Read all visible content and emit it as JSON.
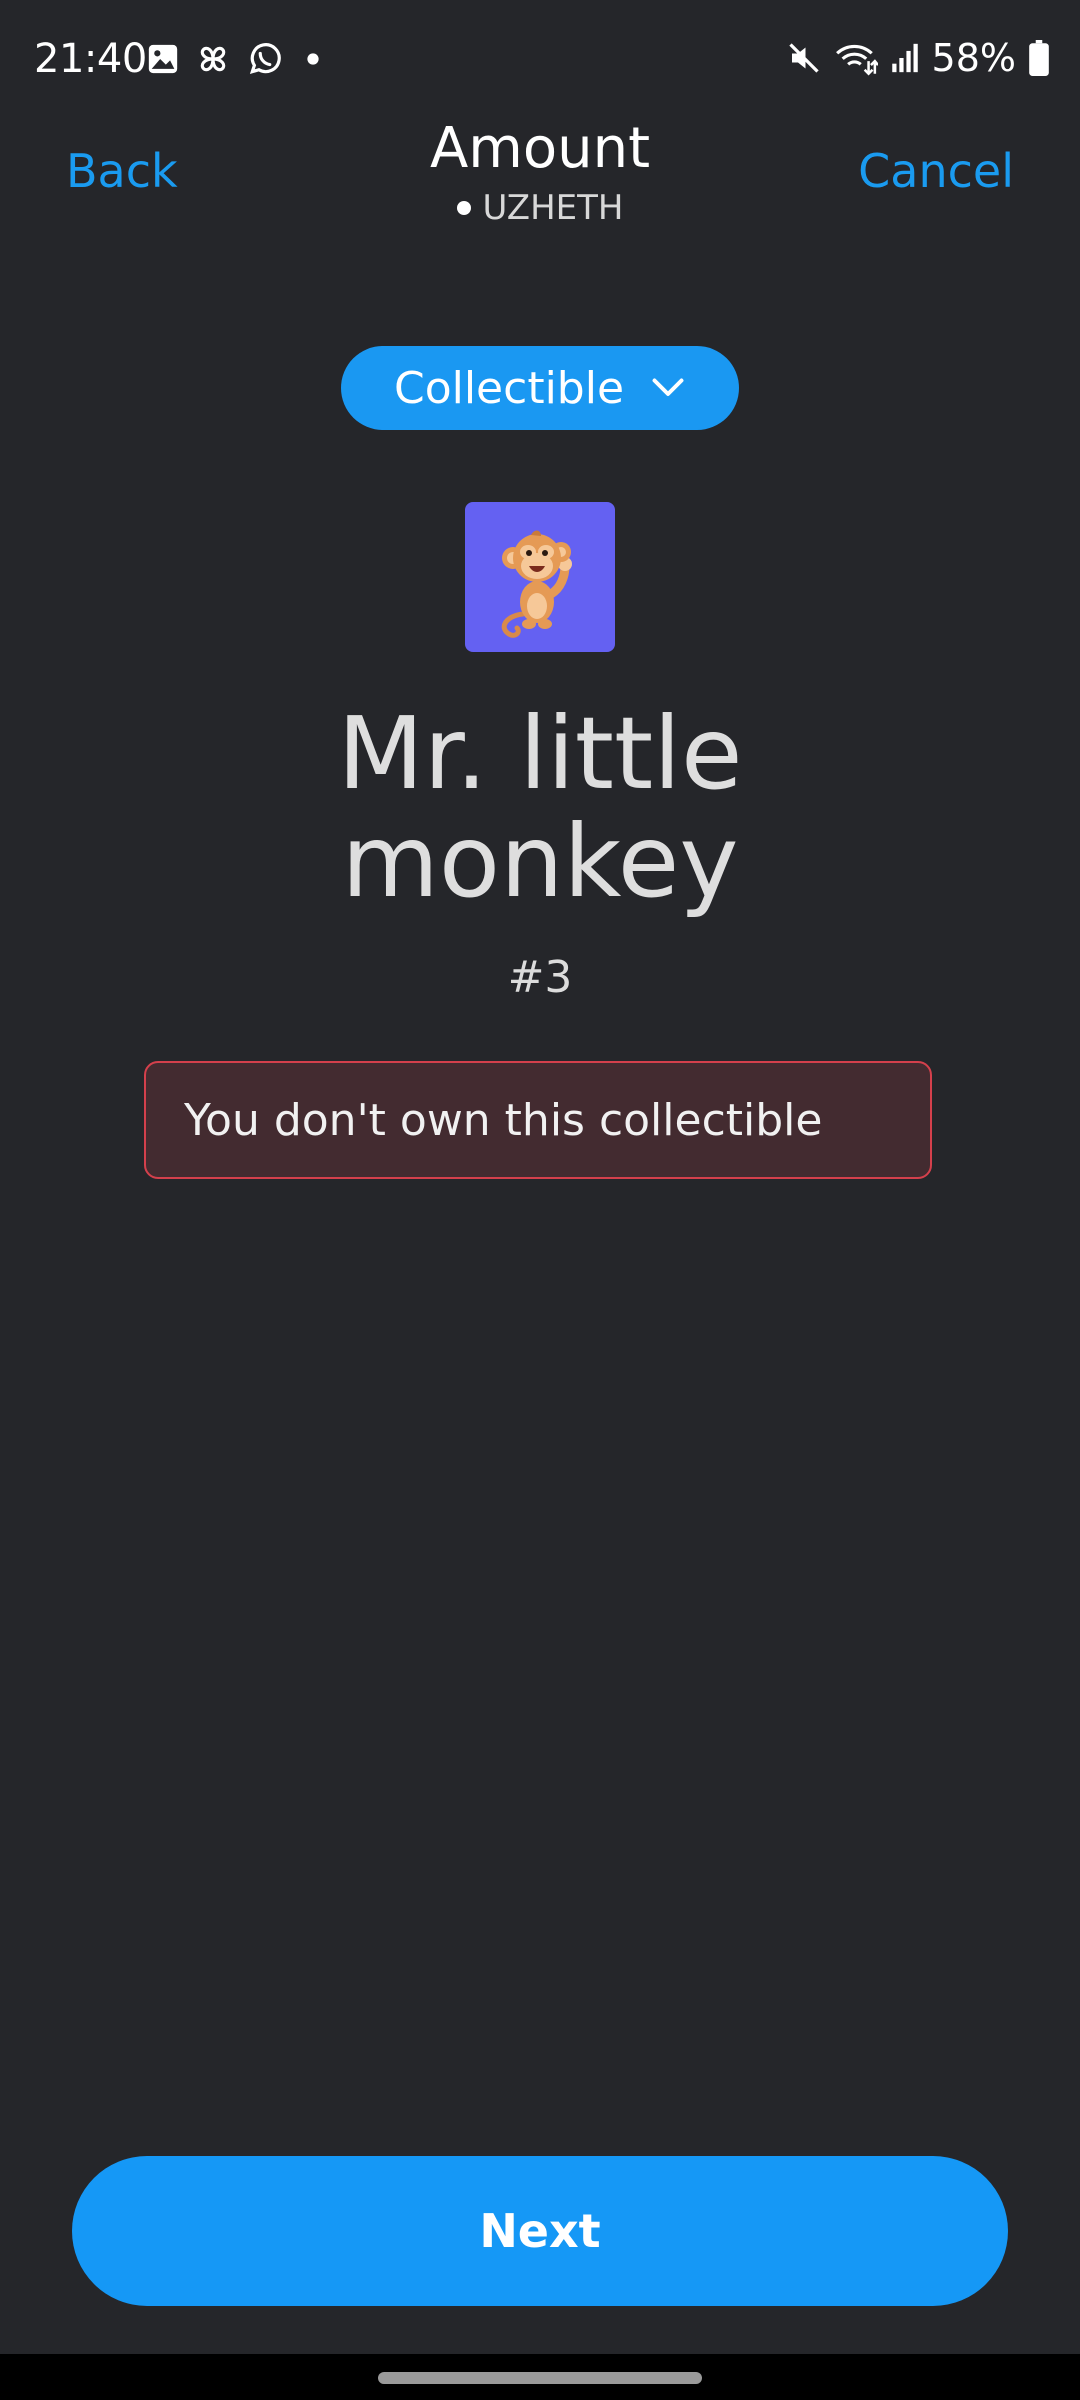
{
  "status_bar": {
    "time": "21:40",
    "battery_text": "58%",
    "left_icons": [
      "gallery-icon",
      "pinwheel-icon",
      "whatsapp-icon",
      "notification-dot-icon"
    ],
    "right_icons": [
      "mute-icon",
      "wifi-icon",
      "signal-icon",
      "battery-icon"
    ]
  },
  "header": {
    "back_label": "Back",
    "title": "Amount",
    "network_name": "UZHETH",
    "cancel_label": "Cancel"
  },
  "asset_selector": {
    "label": "Collectible",
    "icon": "chevron-down-icon"
  },
  "nft": {
    "image_icon": "monkey-illustration",
    "name": "Mr. little monkey",
    "token_id": "#3"
  },
  "error": {
    "message": "You don't own this collectible"
  },
  "footer": {
    "next_label": "Next"
  },
  "colors": {
    "background": "#25262a",
    "accent": "#1a98f2",
    "error_border": "#d4404c",
    "error_bg": "#432b30",
    "nft_bg": "#6461f2"
  }
}
